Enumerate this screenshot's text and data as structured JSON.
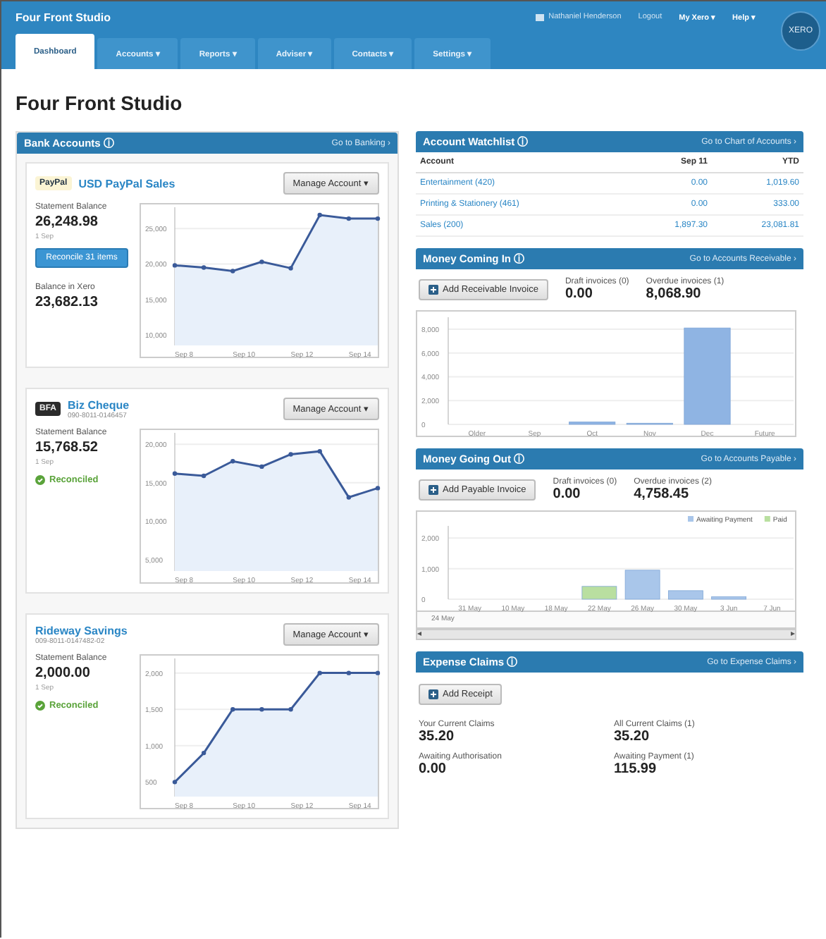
{
  "header": {
    "org": "Four Front Studio",
    "user": "Nathaniel Henderson",
    "links": [
      "Logout",
      "My Xero ▾",
      "Help ▾"
    ],
    "logo": "XERO"
  },
  "tabs": [
    {
      "label": "Dashboard",
      "selected": true
    },
    {
      "label": "Accounts ▾",
      "selected": false
    },
    {
      "label": "Reports ▾",
      "selected": false
    },
    {
      "label": "Adviser ▾",
      "selected": false
    },
    {
      "label": "Contacts ▾",
      "selected": false
    },
    {
      "label": "Settings ▾",
      "selected": false
    }
  ],
  "page_title": "Four Front Studio",
  "bank_accounts": {
    "title": "Bank Accounts ⓘ",
    "link": "Go to Banking ›",
    "accounts": [
      {
        "logo": "PayPal",
        "name": "USD PayPal Sales",
        "manage": "Manage Account ▾",
        "balance_label": "Statement Balance",
        "balance": "26,248.98",
        "date": "1 Sep",
        "status": {
          "kind": "button",
          "label": "Reconcile 31 items"
        },
        "xero_label": "Balance in Xero",
        "xero_balance": "23,682.13",
        "chart_data": {
          "type": "area",
          "categories": [
            "Sep 8",
            null,
            "Sep 10",
            null,
            "Sep 12",
            null,
            "Sep 14",
            null
          ],
          "series": [
            {
              "color": "#3a5a99",
              "marker": true,
              "values": [
                19800,
                19500,
                19000,
                20300,
                19400,
                26900,
                26400,
                26400
              ]
            }
          ],
          "ylim": [
            8500,
            28000
          ],
          "yticks": [
            {
              "value": 10000,
              "label": "10,000"
            },
            {
              "value": 15000,
              "label": "15,000"
            },
            {
              "value": 20000,
              "label": "20,000"
            },
            {
              "value": 25000,
              "label": "25,000"
            }
          ],
          "grid": true
        }
      },
      {
        "logo": "BFA",
        "name": "Biz Cheque",
        "number": "090-8011-0146457",
        "manage": "Manage Account ▾",
        "balance_label": "Statement Balance",
        "balance": "15,768.52",
        "date": "1 Sep",
        "status": {
          "kind": "reconciled",
          "label": "Reconciled"
        },
        "chart_data": {
          "type": "area",
          "categories": [
            "Sep 8",
            null,
            "Sep 10",
            null,
            "Sep 12",
            null,
            "Sep 14",
            null
          ],
          "series": [
            {
              "color": "#3a5a99",
              "marker": true,
              "values": [
                16200,
                15900,
                17800,
                17100,
                18700,
                19100,
                13100,
                14300
              ]
            }
          ],
          "ylim": [
            3500,
            21500
          ],
          "yticks": [
            {
              "value": 5000,
              "label": "5,000"
            },
            {
              "value": 10000,
              "label": "10,000"
            },
            {
              "value": 15000,
              "label": "15,000"
            },
            {
              "value": 20000,
              "label": "20,000"
            }
          ],
          "grid": true
        }
      },
      {
        "name": "Rideway Savings",
        "number": "009-8011-0147482-02",
        "manage": "Manage Account ▾",
        "balance_label": "Statement Balance",
        "balance": "2,000.00",
        "date": "1 Sep",
        "status": {
          "kind": "reconciled",
          "label": "Reconciled"
        },
        "chart_data": {
          "type": "area",
          "categories": [
            "Sep 8",
            null,
            "Sep 10",
            null,
            "Sep 12",
            null,
            "Sep 14",
            null
          ],
          "series": [
            {
              "color": "#3a5a99",
              "marker": true,
              "values": [
                500,
                900,
                1500,
                1500,
                1500,
                2000,
                2000,
                2000
              ]
            }
          ],
          "ylim": [
            300,
            2200
          ],
          "yticks": [
            500,
            {
              "value": 1000,
              "label": "1,000"
            },
            {
              "value": 1500,
              "label": "1,500"
            },
            {
              "value": 2000,
              "label": "2,000"
            }
          ],
          "grid": true
        }
      }
    ]
  },
  "watchlist": {
    "title": "Account Watchlist ⓘ",
    "link": "Go to Chart of Accounts ›",
    "columns": [
      "Account",
      "Sep 11",
      "YTD"
    ],
    "rows": [
      [
        "Entertainment (420)",
        "0.00",
        "1,019.60"
      ],
      [
        "Printing & Stationery (461)",
        "0.00",
        "333.00"
      ],
      [
        "Sales (200)",
        "1,897.30",
        "23,081.81"
      ]
    ]
  },
  "money_in": {
    "title": "Money Coming In ⓘ",
    "link": "Go to Accounts Receivable ›",
    "button": "Add Receivable Invoice",
    "stats": [
      {
        "label": "Draft invoices (0)",
        "value": "0.00"
      },
      {
        "label": "Overdue invoices (1)",
        "value": "8,068.90"
      }
    ],
    "chart_data": {
      "type": "bar",
      "categories": [
        "Older",
        "Sep",
        "Oct",
        "Nov",
        "Dec",
        "Future"
      ],
      "series": [
        {
          "color": "#8fb4e3",
          "values": [
            0,
            0,
            200,
            100,
            8100,
            0
          ]
        }
      ],
      "ylim": [
        0,
        9000
      ],
      "yticks": [
        0,
        {
          "value": 2000,
          "label": "2,000"
        },
        {
          "value": 4000,
          "label": "4,000"
        },
        {
          "value": 6000,
          "label": "6,000"
        },
        {
          "value": 8000,
          "label": "8,000"
        }
      ],
      "grid": true
    }
  },
  "money_out": {
    "title": "Money Going Out ⓘ",
    "link": "Go to Accounts Payable ›",
    "button": "Add Payable Invoice",
    "stats": [
      {
        "label": "Draft invoices (0)",
        "value": "0.00"
      },
      {
        "label": "Overdue invoices (2)",
        "value": "4,758.45"
      }
    ],
    "chart_data": {
      "type": "bar",
      "categories": [
        "31 May",
        "10 May",
        "18 May",
        "22 May",
        "26 May",
        "30 May",
        "3 Jun",
        "7 Jun"
      ],
      "series": [
        {
          "name": "Awaiting Payment",
          "color": "#a9c6ea",
          "values": [
            0,
            0,
            0,
            0,
            950,
            280,
            80,
            0
          ]
        },
        {
          "name": "Paid",
          "color": "#b9dfa0",
          "values": [
            0,
            0,
            0,
            420,
            0,
            0,
            0,
            0
          ]
        }
      ],
      "ylim": [
        0,
        2400
      ],
      "yticks": [
        0,
        {
          "value": 1000,
          "label": "1,000"
        },
        {
          "value": 2000,
          "label": "2,000"
        }
      ],
      "grid": true,
      "legend": "upper right"
    },
    "navigator_label": "24 May",
    "scroll_arrows": [
      "◂",
      "▸"
    ]
  },
  "expense_claims": {
    "title": "Expense Claims ⓘ",
    "link": "Go to Expense Claims ›",
    "button": "Add Receipt",
    "stats": [
      {
        "label": "Your Current Claims",
        "value": "35.20"
      },
      {
        "label": "All Current Claims (1)",
        "value": "35.20"
      },
      {
        "label": "Awaiting Authorisation",
        "value": "0.00"
      },
      {
        "label": "Awaiting Payment (1)",
        "value": "115.99"
      }
    ]
  }
}
